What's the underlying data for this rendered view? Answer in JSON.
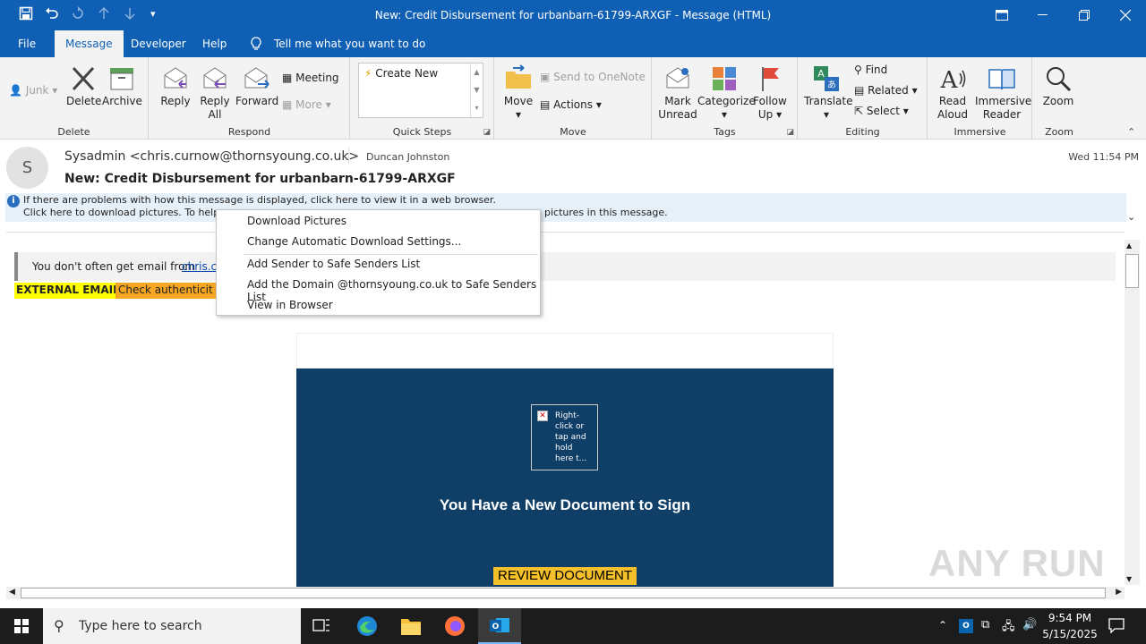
{
  "titlebar": {
    "title": "New: Credit Disbursement for urbanbarn-61799-ARXGF  -  Message (HTML)"
  },
  "menubar": {
    "tabs": [
      {
        "label": "File"
      },
      {
        "label": "Message"
      },
      {
        "label": "Developer"
      },
      {
        "label": "Help"
      }
    ],
    "tell_me": "Tell me what you want to do"
  },
  "ribbon": {
    "delete_group": {
      "junk": "Junk",
      "delete": "Delete",
      "archive": "Archive",
      "label": "Delete"
    },
    "respond_group": {
      "reply": "Reply",
      "reply_all_1": "Reply",
      "reply_all_2": "All",
      "forward": "Forward",
      "meeting": "Meeting",
      "more": "More",
      "label": "Respond"
    },
    "quicksteps_group": {
      "create_new": "Create New",
      "label": "Quick Steps"
    },
    "move_group": {
      "move": "Move",
      "onenote": "Send to OneNote",
      "actions": "Actions",
      "label": "Move"
    },
    "tags_group": {
      "mark_1": "Mark",
      "mark_2": "Unread",
      "categorize": "Categorize",
      "follow_1": "Follow",
      "follow_2": "Up",
      "label": "Tags"
    },
    "editing_group": {
      "translate": "Translate",
      "find": "Find",
      "related": "Related",
      "select": "Select",
      "label": "Editing"
    },
    "immersive_group": {
      "read_1": "Read",
      "read_2": "Aloud",
      "imm_1": "Immersive",
      "imm_2": "Reader",
      "label": "Immersive"
    },
    "zoom_group": {
      "zoom": "Zoom",
      "label": "Zoom"
    }
  },
  "message": {
    "avatar_letter": "S",
    "from": "Sysadmin <chris.curnow@thornsyoung.co.uk>",
    "to": "Duncan Johnston",
    "date": "Wed 11:54 PM",
    "subject": "New: Credit Disbursement for urbanbarn-61799-ARXGF",
    "info_line1": "If there are problems with how this message is displayed, click here to view it in a web browser.",
    "info_line2_start": "Click here to download pictures. To help p",
    "info_line2_end": "pictures in this message."
  },
  "body": {
    "notice_text": "You don't often get email from ",
    "notice_link": "chris.cu",
    "external_label": "EXTERNAL EMAIL:",
    "external_text": " Check authenticit",
    "image_placeholder": "Right-click or tap and hold here t...",
    "headline": "You Have a New Document to Sign",
    "review_button": "REVIEW DOCUMENT"
  },
  "context_menu": {
    "items": [
      {
        "label": "Download Pictures"
      },
      {
        "label": "Change Automatic Download Settings..."
      },
      {
        "label": "Add Sender to Safe Senders List"
      },
      {
        "label": "Add the Domain @thornsyoung.co.uk to Safe Senders List"
      },
      {
        "label": "View in Browser"
      }
    ]
  },
  "watermark": "ANY RUN",
  "taskbar": {
    "search_placeholder": "Type here to search",
    "time": "9:54 PM",
    "date": "5/15/2025"
  },
  "colors": {
    "title_blue": "#0f5fb4",
    "email_dark_blue": "#0f3e66",
    "review_yellow": "#f5c02a",
    "external_yellow": "#ffff00",
    "external_orange": "#f5a623"
  }
}
